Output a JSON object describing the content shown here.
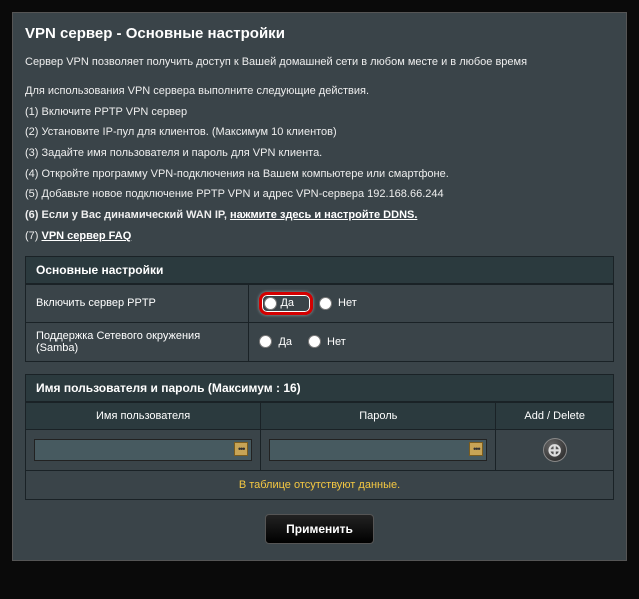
{
  "title": "VPN сервер - Основные настройки",
  "intro": "Сервер VPN позволяет получить доступ к Вашей домашней сети в любом месте и в любое время",
  "steps_heading": "Для использования VPN сервера выполните следующие действия.",
  "steps": {
    "s1": "(1) Включите PPTP VPN сервер",
    "s2": "(2) Установите IP-пул для клиентов. (Максимум 10 клиентов)",
    "s3": "(3) Задайте имя пользователя и пароль для VPN клиента.",
    "s4": "(4) Откройте программу VPN-подключения на Вашем компьютере или смартфоне.",
    "s5": "(5) Добавьте новое подключение PPTP VPN и адрес VPN-сервера 192.168.66.244",
    "s6_prefix": "(6) Если у Вас динамический WAN IP, ",
    "s6_link": "нажмите здесь и настройте DDNS.",
    "s7_prefix": "(7) ",
    "s7_link": "VPN сервер FAQ"
  },
  "sections": {
    "basic": "Основные настройки",
    "users": "Имя пользователя и пароль (Максимум : 16)"
  },
  "settings": {
    "enable_pptp": "Включить сервер PPTP",
    "samba": "Поддержка Сетевого окружения (Samba)",
    "yes": "Да",
    "no": "Нет"
  },
  "table": {
    "col_user": "Имя пользователя",
    "col_pass": "Пароль",
    "col_action": "Add / Delete",
    "empty": "В таблице отсутствуют данные."
  },
  "buttons": {
    "apply": "Применить"
  }
}
